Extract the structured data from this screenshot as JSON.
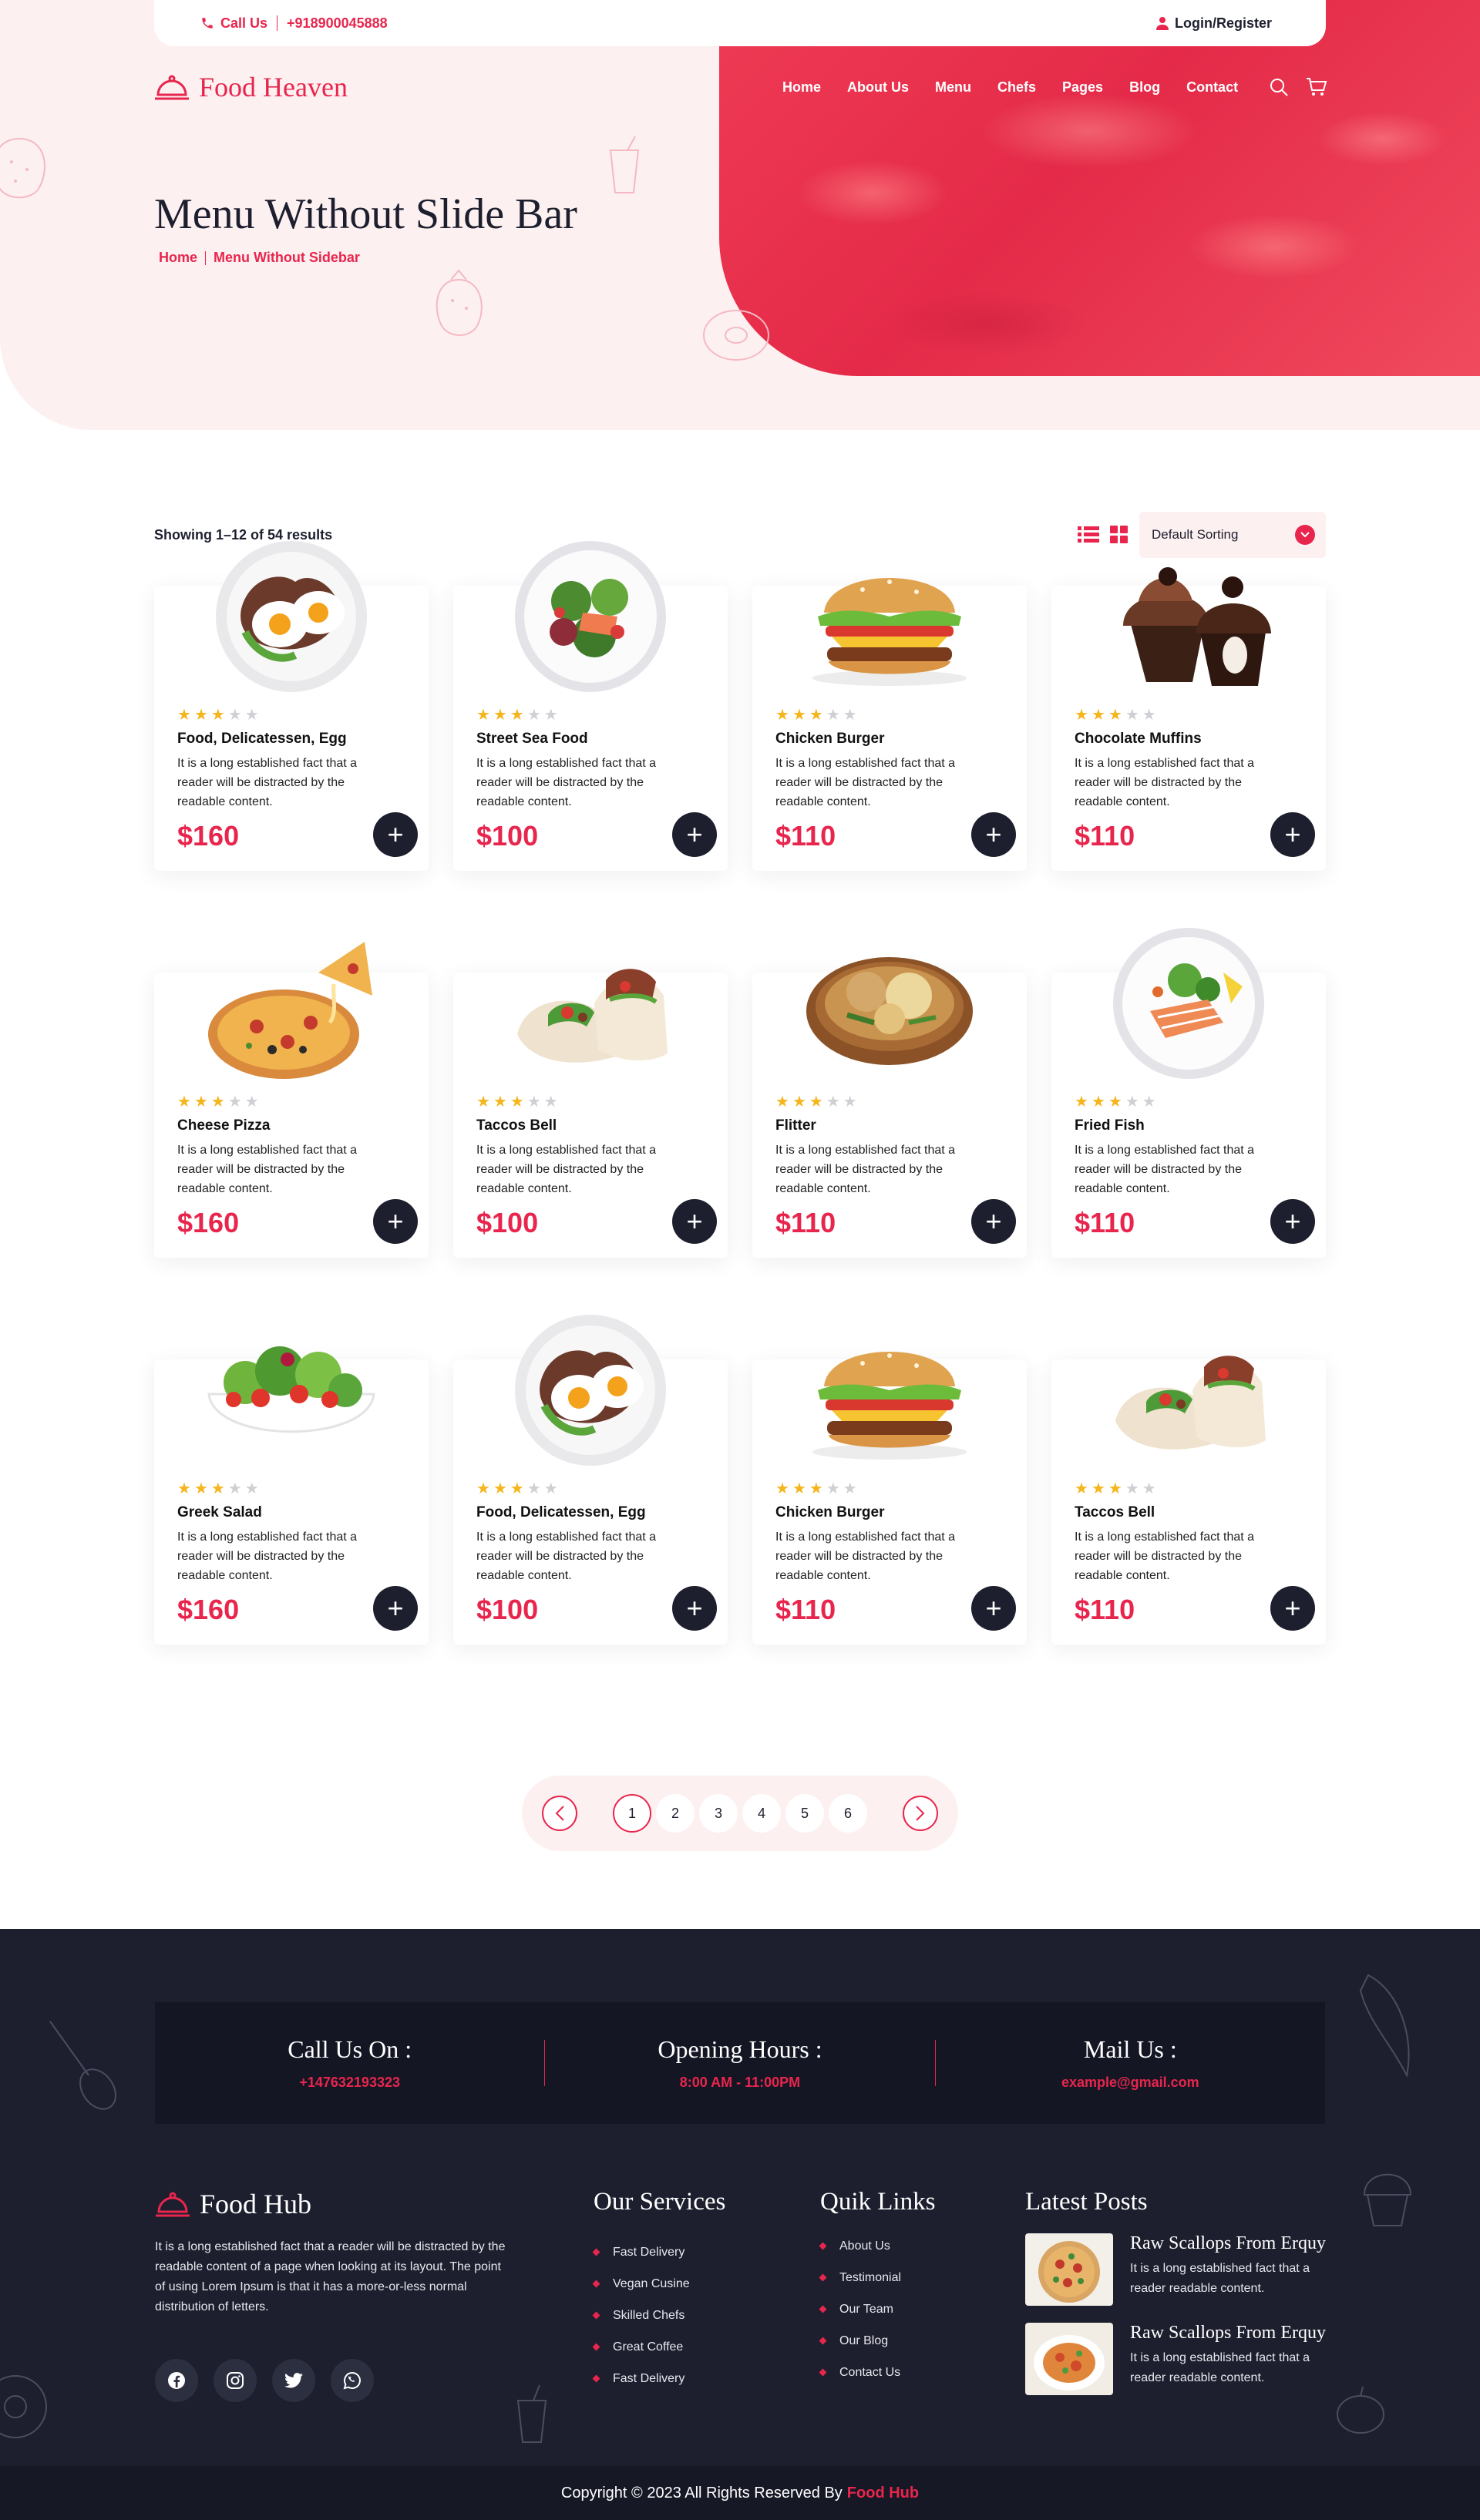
{
  "topbar": {
    "call_label": "Call Us",
    "phone": "+918900045888",
    "login": "Login/Register"
  },
  "brand": {
    "name": "Food Heaven"
  },
  "nav": {
    "items": [
      "Home",
      "About Us",
      "Menu",
      "Chefs",
      "Pages",
      "Blog",
      "Contact"
    ]
  },
  "hero": {
    "title": "Menu Without Slide Bar",
    "breadcrumb_home": "Home",
    "breadcrumb_current": "Menu Without Sidebar"
  },
  "toolbar": {
    "results": "Showing 1–12 of 54 results",
    "sort_value": "Default Sorting"
  },
  "products": [
    {
      "name": "Food, Delicatessen, Egg",
      "desc": "It is a long established fact that a reader will be distracted by the readable content.",
      "price": "$160",
      "rating": 3,
      "image": "egg-plate"
    },
    {
      "name": "Street Sea Food",
      "desc": "It is a long established fact that a reader will be distracted by the readable content.",
      "price": "$100",
      "rating": 3,
      "image": "salmon-salad"
    },
    {
      "name": "Chicken Burger",
      "desc": "It is a long established fact that a reader will be distracted by the readable content.",
      "price": "$110",
      "rating": 3,
      "image": "burger"
    },
    {
      "name": "Chocolate Muffins",
      "desc": "It is a long established fact that a reader will be distracted by the readable content.",
      "price": "$110",
      "rating": 3,
      "image": "muffins"
    },
    {
      "name": "Cheese Pizza",
      "desc": "It is a long established fact that a reader will be distracted by the readable content.",
      "price": "$160",
      "rating": 3,
      "image": "pizza"
    },
    {
      "name": "Taccos Bell",
      "desc": "It is a long established fact that a reader will be distracted by the readable content.",
      "price": "$100",
      "rating": 3,
      "image": "wrap"
    },
    {
      "name": "Flitter",
      "desc": "It is a long established fact that a reader will be distracted by the readable content.",
      "price": "$110",
      "rating": 3,
      "image": "flitter"
    },
    {
      "name": "Fried Fish",
      "desc": "It is a long established fact that a reader will be distracted by the readable content.",
      "price": "$110",
      "rating": 3,
      "image": "fish-plate"
    },
    {
      "name": "Greek Salad",
      "desc": "It is a long established fact that a reader will be distracted by the readable content.",
      "price": "$160",
      "rating": 3,
      "image": "salad-bowl"
    },
    {
      "name": "Food, Delicatessen, Egg",
      "desc": "It is a long established fact that a reader will be distracted by the readable content.",
      "price": "$100",
      "rating": 3,
      "image": "egg-plate"
    },
    {
      "name": "Chicken Burger",
      "desc": "It is a long established fact that a reader will be distracted by the readable content.",
      "price": "$110",
      "rating": 3,
      "image": "burger"
    },
    {
      "name": "Taccos Bell",
      "desc": "It is a long established fact that a reader will be distracted by the readable content.",
      "price": "$110",
      "rating": 3,
      "image": "wrap"
    }
  ],
  "pagination": {
    "pages": [
      "1",
      "2",
      "3",
      "4",
      "5",
      "6"
    ],
    "current": "1"
  },
  "footer": {
    "contacts": [
      {
        "title": "Call Us On :",
        "value": "+147632193323"
      },
      {
        "title": "Opening Hours :",
        "value": "8:00 AM - 11:00PM"
      },
      {
        "title": "Mail Us :",
        "value": "example@gmail.com"
      }
    ],
    "brand": "Food Hub",
    "about": "It is a long established fact that a reader will be distracted by the readable content of a page when looking at its layout. The point of using Lorem Ipsum is that it has a more-or-less normal distribution of letters.",
    "services_title": "Our Services",
    "services": [
      "Fast Delivery",
      "Vegan Cusine",
      "Skilled Chefs",
      "Great Coffee",
      "Fast Delivery"
    ],
    "links_title": "Quik Links",
    "links": [
      "About Us",
      "Testimonial",
      "Our Team",
      "Our Blog",
      "Contact Us"
    ],
    "posts_title": "Latest Posts",
    "posts": [
      {
        "title": "Raw Scallops From Erquy",
        "excerpt": "It is a long established fact that a reader readable content."
      },
      {
        "title": "Raw Scallops From Erquy",
        "excerpt": "It is a long established fact that a reader readable content."
      }
    ],
    "copyright_prefix": "Copyright © 2023 All Rights Reserved By",
    "copyright_brand": "Food Hub"
  },
  "colors": {
    "accent": "#e8264d",
    "dark": "#1d1f2e",
    "pink_bg": "#fdf0f1",
    "star": "#f5b51c"
  }
}
